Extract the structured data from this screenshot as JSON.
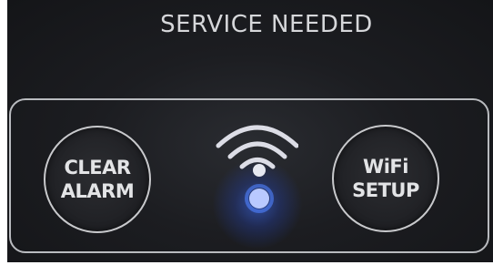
{
  "status_label": "SERVICE NEEDED",
  "clear_alarm_button": {
    "line1": "CLEAR",
    "line2": "ALARM"
  },
  "wifi_setup_button": {
    "line1": "WiFi",
    "line2": "SETUP"
  },
  "wifi_indicator": {
    "icon": "wifi-icon",
    "led_color": "#3f6dff",
    "led_state": "on"
  },
  "colors": {
    "panel": "#1c1d21",
    "text": "#d6d7da",
    "outline": "#b9bbbf",
    "led_blue": "#3f6dff"
  }
}
